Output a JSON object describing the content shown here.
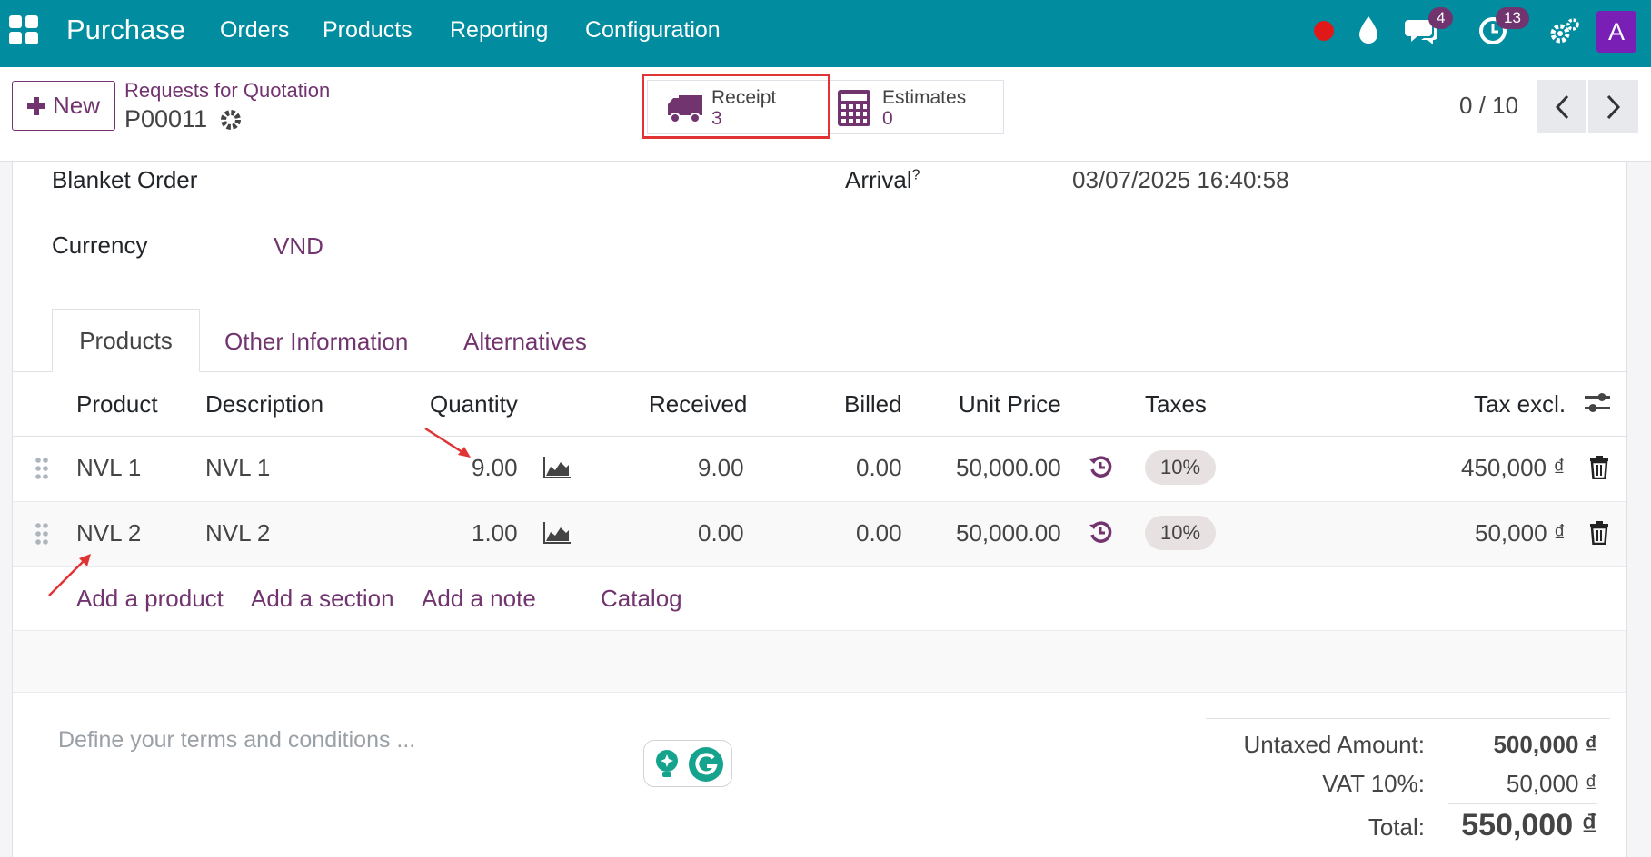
{
  "navbar": {
    "app_name": "Purchase",
    "menu": [
      "Orders",
      "Products",
      "Reporting",
      "Configuration"
    ],
    "chat_count": "4",
    "activity_count": "13",
    "avatar_letter": "A"
  },
  "control_panel": {
    "new_label": "New",
    "breadcrumb": "Requests for Quotation",
    "record_name": "P00011",
    "receipt_label": "Receipt",
    "receipt_count": "3",
    "estimates_label": "Estimates",
    "estimates_count": "0",
    "pager": "0 / 10"
  },
  "form": {
    "blanket_order_label": "Blanket Order",
    "arrival_label": "Arrival",
    "arrival_help": "?",
    "arrival_value": "03/07/2025 16:40:58",
    "currency_label": "Currency",
    "currency_value": "VND"
  },
  "tabs": [
    "Products",
    "Other Information",
    "Alternatives"
  ],
  "table": {
    "headers": {
      "product": "Product",
      "description": "Description",
      "quantity": "Quantity",
      "received": "Received",
      "billed": "Billed",
      "unit_price": "Unit Price",
      "taxes": "Taxes",
      "tax_excl": "Tax excl."
    },
    "rows": [
      {
        "product": "NVL 1",
        "description": "NVL 1",
        "quantity": "9.00",
        "received": "9.00",
        "billed": "0.00",
        "unit_price": "50,000.00",
        "tax": "10%",
        "subtotal": "450,000 ₫"
      },
      {
        "product": "NVL 2",
        "description": "NVL 2",
        "quantity": "1.00",
        "received": "0.00",
        "billed": "0.00",
        "unit_price": "50,000.00",
        "tax": "10%",
        "subtotal": "50,000 ₫"
      }
    ],
    "add_links": {
      "product": "Add a product",
      "section": "Add a section",
      "note": "Add a note",
      "catalog": "Catalog"
    }
  },
  "terms_placeholder": "Define your terms and conditions ...",
  "totals": {
    "untaxed_label": "Untaxed Amount:",
    "untaxed_value": "500,000 ₫",
    "vat_label": "VAT 10%:",
    "vat_value": "50,000 ₫",
    "total_label": "Total:",
    "total_value": "550,000 ₫"
  },
  "colors": {
    "navbar": "#018d9f",
    "accent": "#71346e",
    "highlight": "#e03434"
  }
}
